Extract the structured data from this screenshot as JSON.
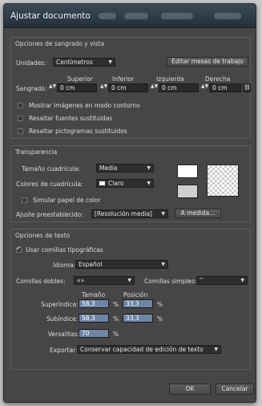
{
  "window": {
    "title": "Ajustar documento"
  },
  "bleed": {
    "group_title": "Opciones de sangrado y vista",
    "units_label": "Unidades:",
    "units_value": "Centímetros",
    "edit_artboards_label": "Editar mesas de trabajo",
    "top_label": "Superior",
    "bottom_label": "Inferior",
    "left_label": "Izquierda",
    "right_label": "Derecha",
    "bleed_label": "Sangrado:",
    "top_value": "0 cm",
    "bottom_value": "0 cm",
    "left_value": "0 cm",
    "right_value": "0 cm",
    "outline_images_label": "Mostrar imágenes en modo contorno",
    "highlight_fonts_label": "Resaltar fuentes sustituidas",
    "highlight_glyphs_label": "Resaltar pictogramas sustituidos"
  },
  "transparency": {
    "group_title": "Transparencia",
    "grid_size_label": "Tamaño cuadrícula:",
    "grid_size_value": "Media",
    "grid_colors_label": "Colores de cuadrícula:",
    "grid_colors_value": "Claro",
    "simulate_paper_label": "Simular papel de color",
    "preset_label": "Ajuste preestablecido:",
    "preset_value": "[Resolución media]",
    "custom_button_label": "A medida..."
  },
  "text": {
    "group_title": "Opciones de texto",
    "typographic_quotes_label": "Usar comillas tipográficas",
    "language_label": "Idioma:",
    "language_value": "Español",
    "double_quotes_label": "Comillas dobles:",
    "double_quotes_value": "«»",
    "single_quotes_label": "Comillas simples:",
    "single_quotes_value": "‘’",
    "size_col_label": "Tamaño",
    "position_col_label": "Posición",
    "superscript_label": "Superíndice:",
    "superscript_size": "58,3",
    "superscript_position": "33,3",
    "subscript_label": "Subíndice:",
    "subscript_size": "58,3",
    "subscript_position": "33,3",
    "smallcaps_label": "Versalitas:",
    "smallcaps_value": "70",
    "percent": "%",
    "export_label": "Exportar:",
    "export_value": "Conservar capacidad de edición de texto"
  },
  "footer": {
    "ok_label": "OK",
    "cancel_label": "Cancelar"
  }
}
